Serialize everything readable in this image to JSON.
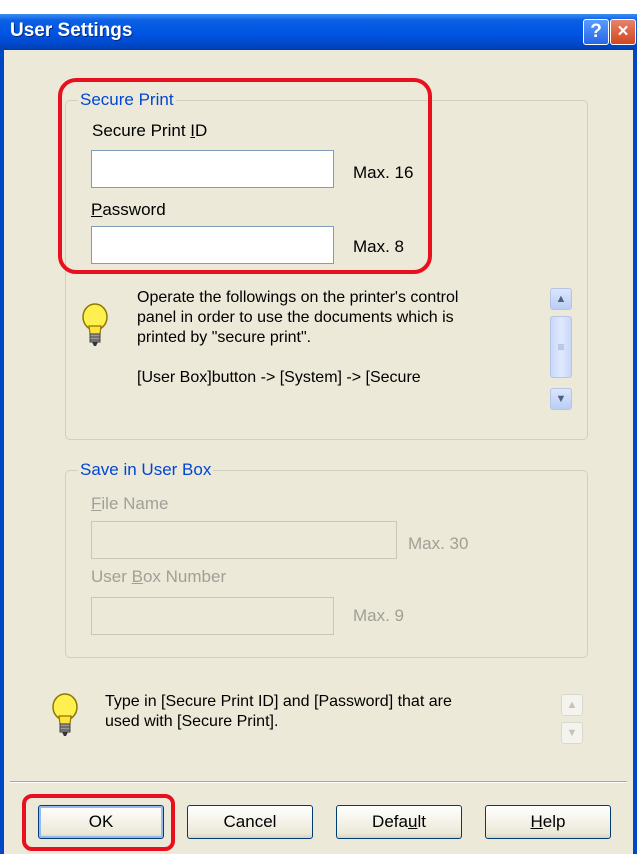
{
  "window": {
    "title": "User Settings",
    "help_glyph": "?",
    "close_glyph": "×"
  },
  "secure_print": {
    "group_label": "Secure Print",
    "id_label_pre": "Secure Print ",
    "id_label_accel": "I",
    "id_label_post": "D",
    "id_value": "",
    "id_max": "Max. 16",
    "password_label_accel": "P",
    "password_label_post": "assword",
    "password_value": "",
    "password_max": "Max. 8",
    "info_line1": "Operate the followings on the printer's control",
    "info_line2": "panel in order to use the documents which is",
    "info_line3": "printed by \"secure print\".",
    "info_line4": "[User Box]button -> [System] -> [Secure"
  },
  "user_box": {
    "group_label": "Save in User Box",
    "file_label_accel": "F",
    "file_label_post": "ile Name",
    "file_value": "",
    "file_max": "Max. 30",
    "number_label_pre": "User ",
    "number_label_accel": "B",
    "number_label_post": "ox Number",
    "number_value": "",
    "number_max": "Max. 9"
  },
  "hint": {
    "line1": "Type in [Secure Print ID] and [Password] that are",
    "line2": "used with [Secure Print]."
  },
  "buttons": {
    "ok": "OK",
    "cancel": "Cancel",
    "default_pre": "Defa",
    "default_accel": "u",
    "default_post": "lt",
    "help_accel": "H",
    "help_post": "elp"
  },
  "icons": {
    "bulb": "lightbulb-icon",
    "scroll_up": "arrow-up-icon",
    "scroll_down": "arrow-down-icon"
  },
  "colors": {
    "title_bar": "#0054e3",
    "group_label": "#0046d5",
    "highlight": "#e8101e",
    "dialog_bg": "#ece9d8"
  }
}
